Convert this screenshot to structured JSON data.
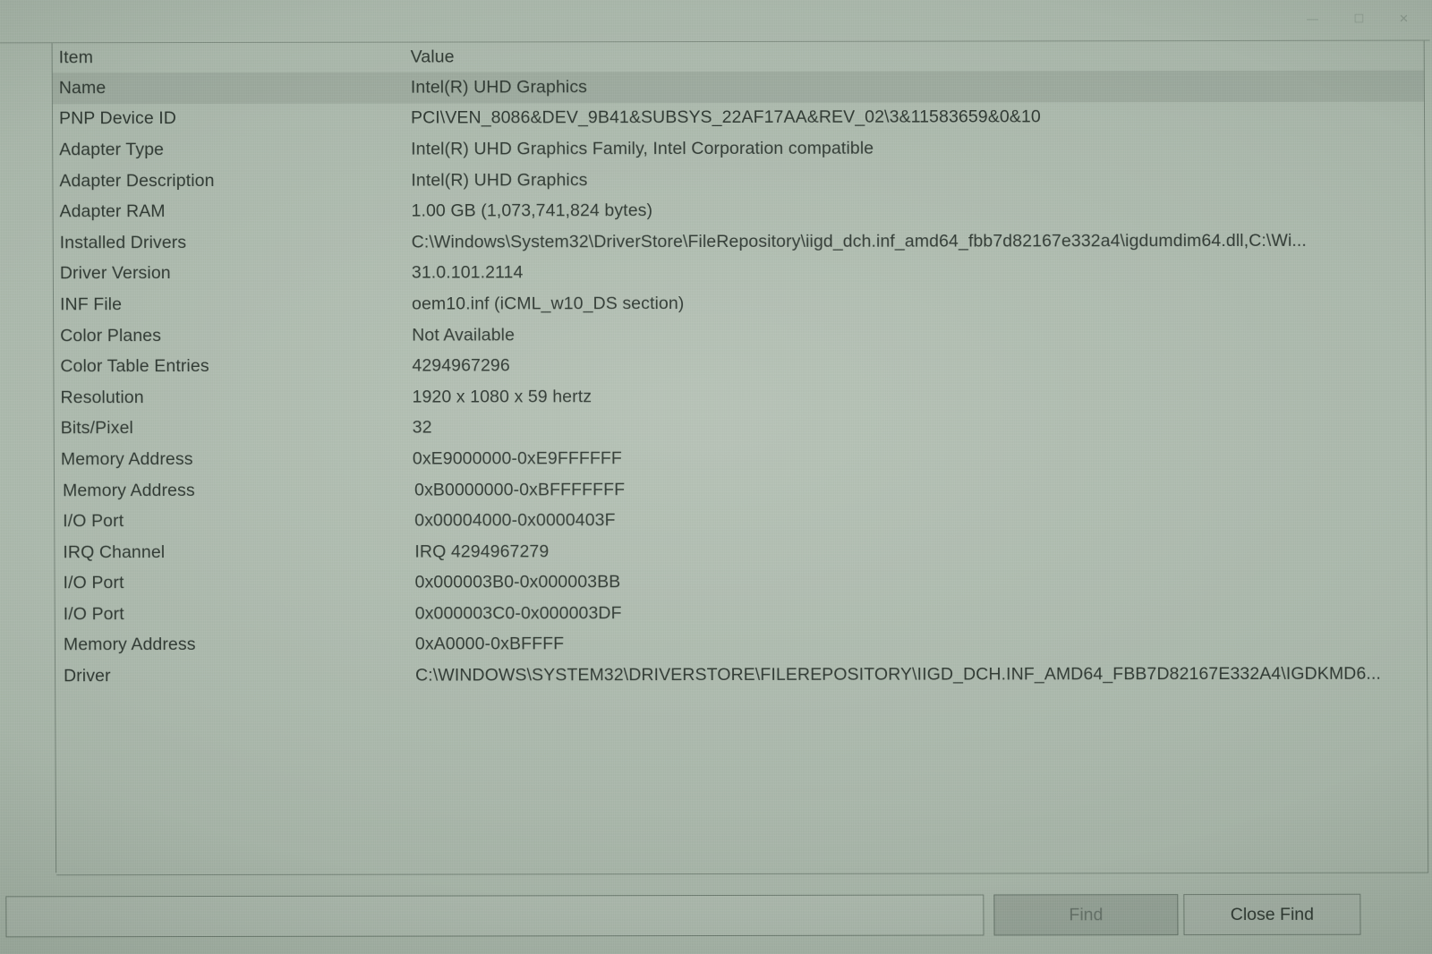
{
  "window": {
    "controls": [
      {
        "name": "minimize",
        "glyph": "—"
      },
      {
        "name": "maximize",
        "glyph": "☐"
      },
      {
        "name": "close",
        "glyph": "✕"
      }
    ]
  },
  "table": {
    "columns": [
      "Item",
      "Value"
    ],
    "selected_row_index": 0,
    "rows": [
      {
        "item": "Name",
        "value": "Intel(R) UHD Graphics"
      },
      {
        "item": "PNP Device ID",
        "value": "PCI\\VEN_8086&DEV_9B41&SUBSYS_22AF17AA&REV_02\\3&11583659&0&10"
      },
      {
        "item": "Adapter Type",
        "value": "Intel(R) UHD Graphics Family, Intel Corporation compatible"
      },
      {
        "item": "Adapter Description",
        "value": "Intel(R) UHD Graphics"
      },
      {
        "item": "Adapter RAM",
        "value": "1.00 GB (1,073,741,824 bytes)"
      },
      {
        "item": "Installed Drivers",
        "value": "C:\\Windows\\System32\\DriverStore\\FileRepository\\iigd_dch.inf_amd64_fbb7d82167e332a4\\igdumdim64.dll,C:\\Wi..."
      },
      {
        "item": "Driver Version",
        "value": "31.0.101.2114"
      },
      {
        "item": "INF File",
        "value": "oem10.inf (iCML_w10_DS section)"
      },
      {
        "item": "Color Planes",
        "value": "Not Available"
      },
      {
        "item": "Color Table Entries",
        "value": "4294967296"
      },
      {
        "item": "Resolution",
        "value": "1920 x 1080 x 59 hertz"
      },
      {
        "item": "Bits/Pixel",
        "value": "32"
      },
      {
        "item": "Memory Address",
        "value": "0xE9000000-0xE9FFFFFF"
      },
      {
        "item": "Memory Address",
        "value": "0xB0000000-0xBFFFFFFF"
      },
      {
        "item": "I/O Port",
        "value": "0x00004000-0x0000403F"
      },
      {
        "item": "IRQ Channel",
        "value": "IRQ 4294967279"
      },
      {
        "item": "I/O Port",
        "value": "0x000003B0-0x000003BB"
      },
      {
        "item": "I/O Port",
        "value": "0x000003C0-0x000003DF"
      },
      {
        "item": "Memory Address",
        "value": "0xA0000-0xBFFFF"
      },
      {
        "item": "Driver",
        "value": "C:\\WINDOWS\\SYSTEM32\\DRIVERSTORE\\FILEREPOSITORY\\IIGD_DCH.INF_AMD64_FBB7D82167E332A4\\IGDKMD6..."
      }
    ]
  },
  "findbar": {
    "search_value": "",
    "search_placeholder": "",
    "find_label": "Find",
    "find_enabled": false,
    "close_find_label": "Close Find"
  },
  "colors": {
    "screen_tint": "#aab7ab",
    "text": "#26342b",
    "border": "#465c4c",
    "selected_row": "#8c9c90"
  }
}
